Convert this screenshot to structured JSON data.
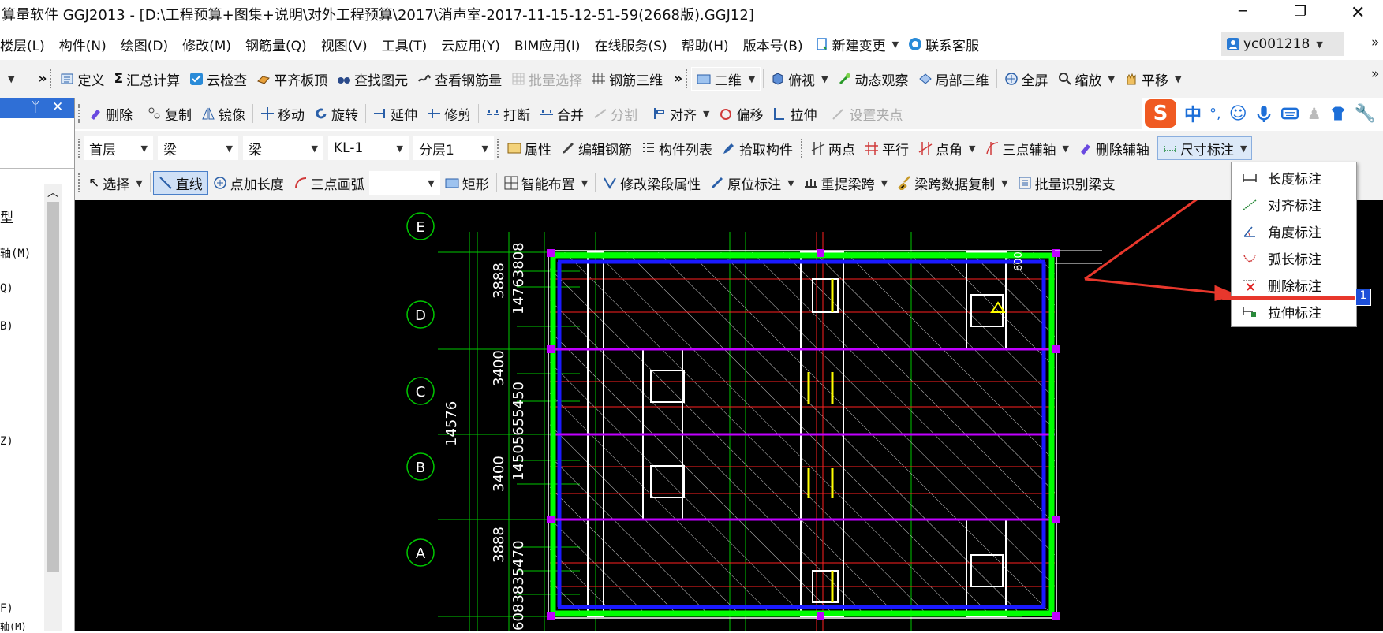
{
  "window": {
    "title": "算量软件 GGJ2013 - [D:\\工程预算+图集+说明\\对外工程预算\\2017\\消声室-2017-11-15-12-51-59(2668版).GGJ12]",
    "controls": [
      "─",
      "❐",
      "✕"
    ]
  },
  "menubar": {
    "items": [
      "楼层(L)",
      "构件(N)",
      "绘图(D)",
      "修改(M)",
      "钢筋量(Q)",
      "视图(V)",
      "工具(T)",
      "云应用(Y)",
      "BIM应用(I)",
      "在线服务(S)",
      "帮助(H)",
      "版本号(B)",
      "新建变更",
      "联系客服"
    ],
    "user": "yc001218"
  },
  "toolbar1": {
    "items": [
      "定义",
      "汇总计算",
      "云检查",
      "平齐板顶",
      "查找图元",
      "查看钢筋量",
      "批量选择",
      "钢筋三维"
    ],
    "view_items": [
      "二维",
      "俯视",
      "动态观察",
      "局部三维",
      "全屏",
      "缩放",
      "平移"
    ],
    "sum_glyph": "Σ",
    "more": "»"
  },
  "toolbar2": {
    "items": [
      "删除",
      "复制",
      "镜像",
      "移动",
      "旋转",
      "延伸",
      "修剪",
      "打断",
      "合并",
      "分割",
      "对齐",
      "偏移",
      "拉伸",
      "设置夹点"
    ],
    "ime_items": [
      "中",
      "°,"
    ]
  },
  "toolbar3": {
    "combos": [
      "首层",
      "梁",
      "梁",
      "KL-1",
      "分层1"
    ],
    "items": [
      "属性",
      "编辑钢筋",
      "构件列表",
      "拾取构件",
      "两点",
      "平行",
      "点角",
      "三点辅轴",
      "删除辅轴",
      "尺寸标注"
    ]
  },
  "toolbar4": {
    "items": [
      "选择",
      "直线",
      "点加长度",
      "三点画弧",
      "矩形",
      "智能布置",
      "修改梁段属性",
      "原位标注",
      "重提梁跨",
      "梁跨数据复制",
      "批量识别梁支"
    ]
  },
  "leftpanel": {
    "pin": "ᛘ",
    "close": "✕",
    "up": "︿",
    "items": [
      "型",
      "轴(M)",
      "Q)",
      "B)",
      "Z)",
      "F)",
      "轴(M)"
    ]
  },
  "dropdown": {
    "items": [
      "长度标注",
      "对齐标注",
      "角度标注",
      "弧长标注",
      "删除标注",
      "拉伸标注"
    ]
  },
  "drawing": {
    "axes": [
      "E",
      "D",
      "C",
      "B",
      "A"
    ],
    "dims": [
      "3888",
      "14763808",
      "3400",
      "14505655450",
      "14576",
      "3400",
      "3888",
      "6083835470",
      "600"
    ],
    "highlight_text": "1"
  },
  "colors": {
    "accent_red": "#e8372c",
    "grid_green": "#00c800",
    "wall_green": "#00ff00",
    "beam_blue": "#1a1aff",
    "purple": "#c000ff",
    "yellow": "#ffff00"
  }
}
